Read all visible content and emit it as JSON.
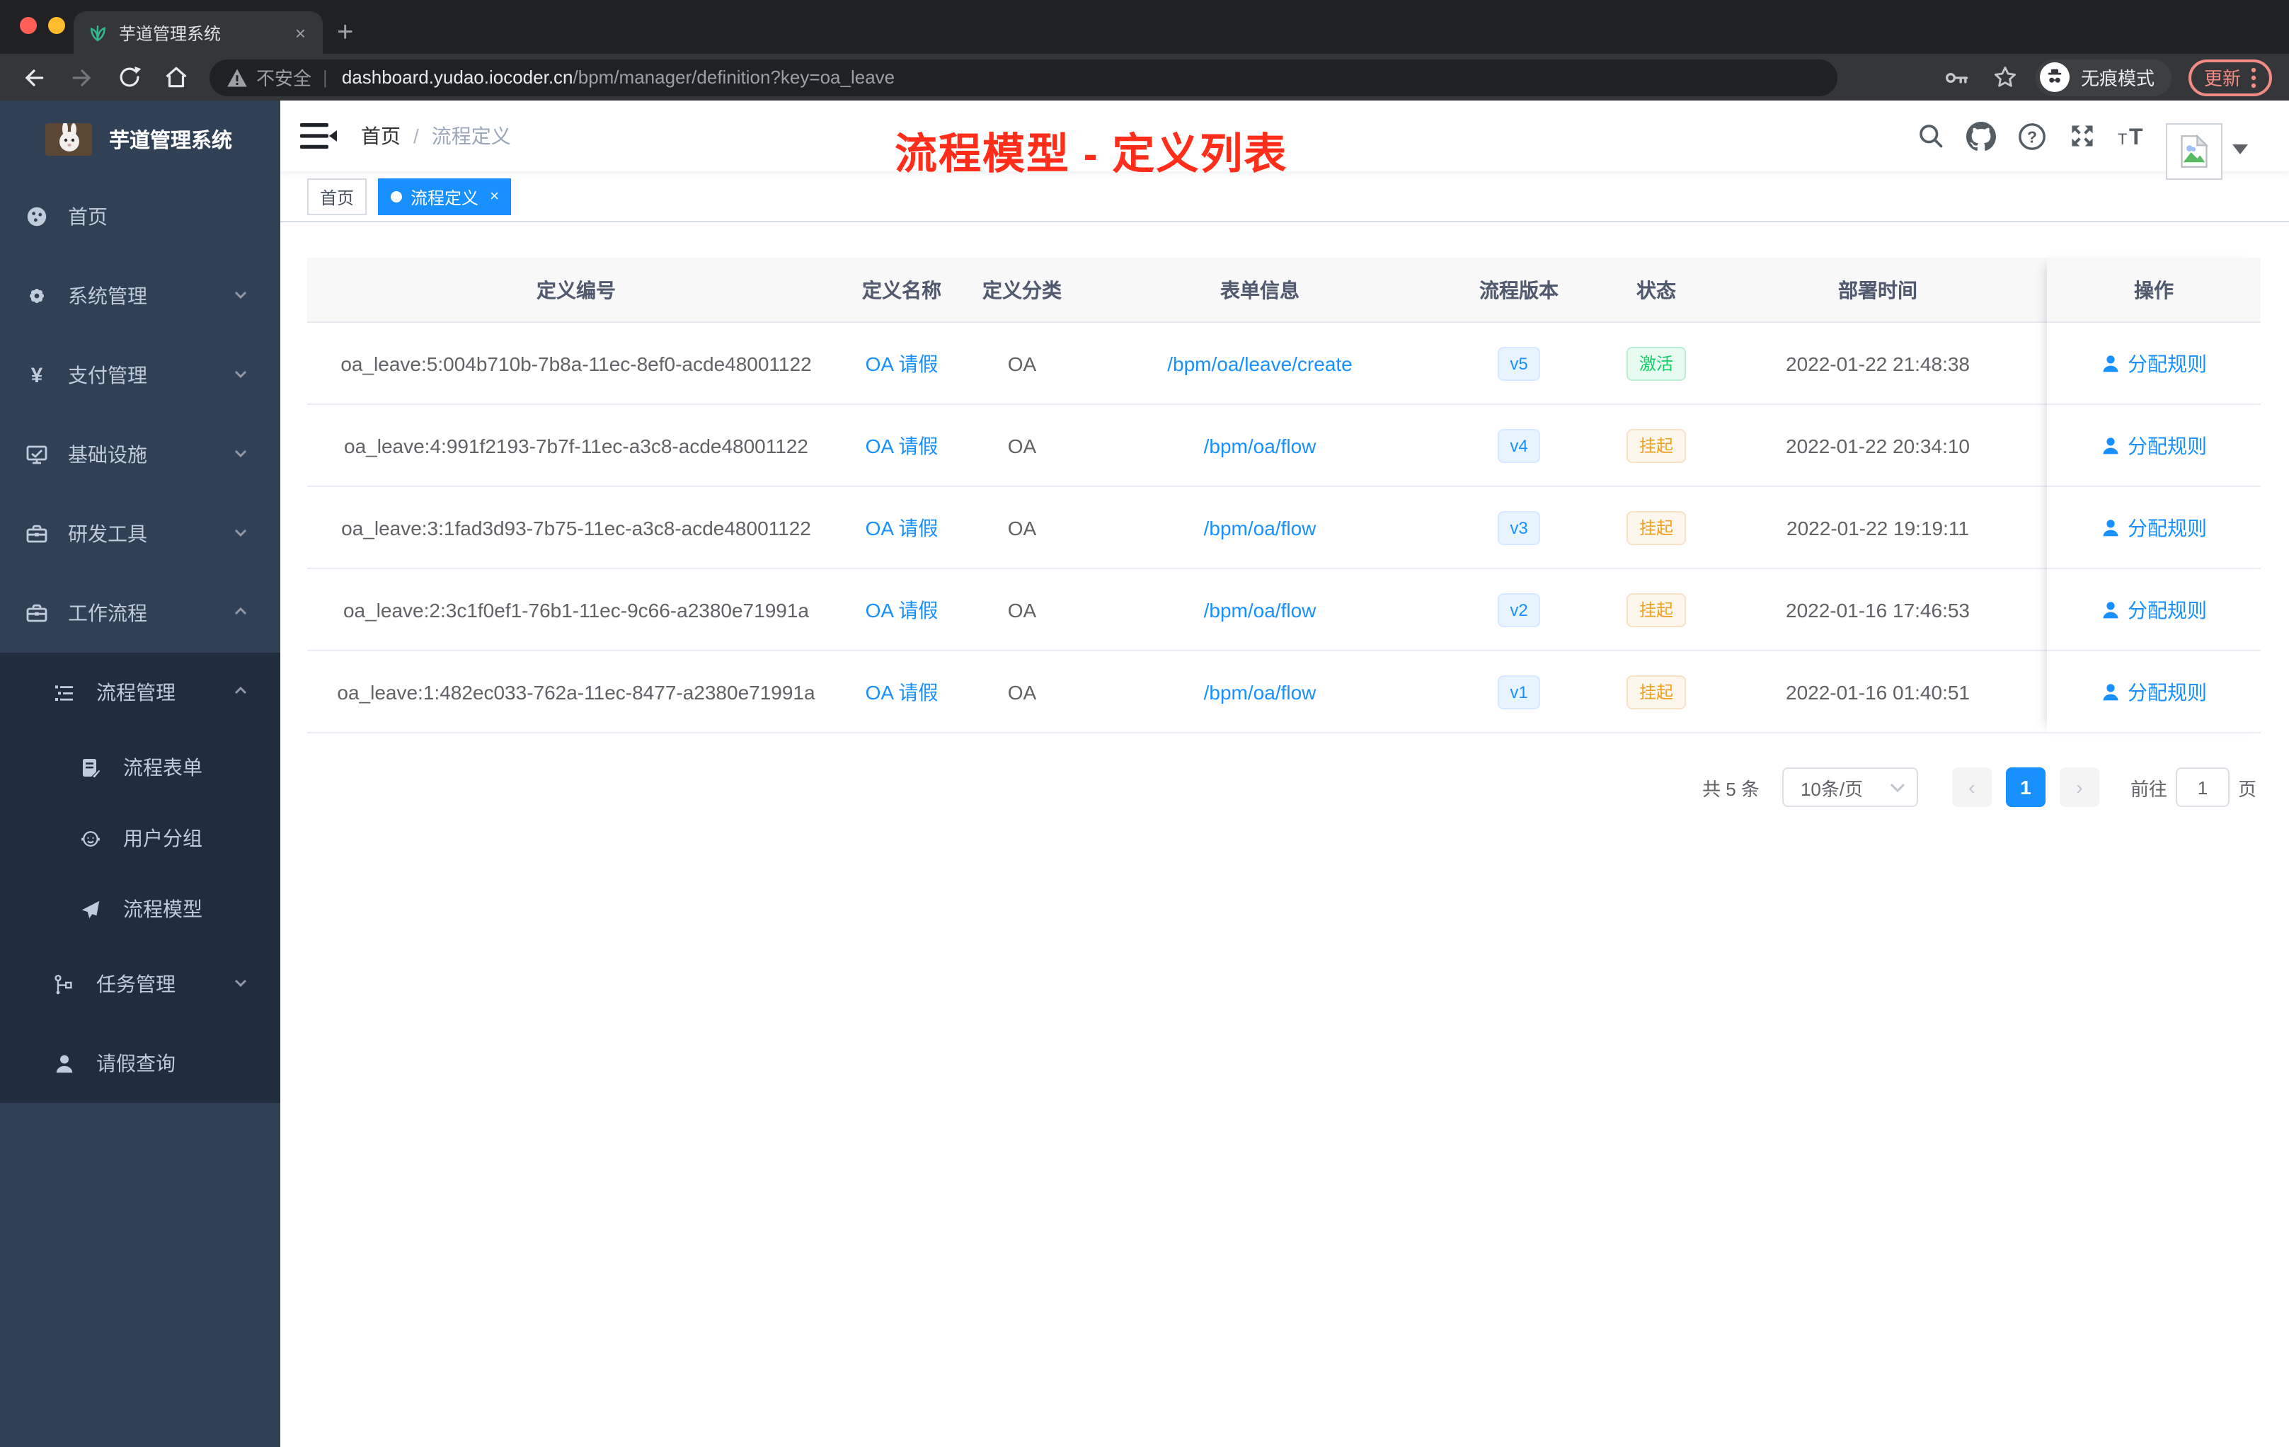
{
  "browser": {
    "tab_title": "芋道管理系统",
    "tab_close_glyph": "×",
    "new_tab_glyph": "+",
    "security_label": "不安全",
    "url_separator": "|",
    "url_domain": "dashboard.yudao.iocoder.cn",
    "url_path": "/bpm/manager/definition?key=oa_leave",
    "incognito_label": "无痕模式",
    "update_label": "更新",
    "window_colors": {
      "close": "#ff5f57",
      "minimize": "#febc2e",
      "zoom": "#28c840"
    }
  },
  "sidebar": {
    "title": "芋道管理系统",
    "logo": "rabbit-avatar",
    "yuan_glyph": "¥",
    "colors": {
      "bg": "#304156",
      "submenu_bg": "#1f2d3d",
      "text": "#bfcbd9"
    },
    "items": [
      {
        "label": "首页",
        "icon": "dashboard-icon",
        "level": 1
      },
      {
        "label": "系统管理",
        "icon": "gear-icon",
        "level": 1,
        "chevron": "down"
      },
      {
        "label": "支付管理",
        "icon": "yuan-icon",
        "level": 1,
        "chevron": "down"
      },
      {
        "label": "基础设施",
        "icon": "monitor-icon",
        "level": 1,
        "chevron": "down"
      },
      {
        "label": "研发工具",
        "icon": "toolbox-icon",
        "level": 1,
        "chevron": "down"
      },
      {
        "label": "工作流程",
        "icon": "briefcase-icon",
        "level": 1,
        "chevron": "up",
        "expanded": true
      },
      {
        "label": "流程管理",
        "icon": "list-tree-icon",
        "level": 2,
        "chevron": "up",
        "expanded": true
      },
      {
        "label": "流程表单",
        "icon": "form-doc-icon",
        "level": 3
      },
      {
        "label": "用户分组",
        "icon": "user-group-icon",
        "level": 3
      },
      {
        "label": "流程模型",
        "icon": "paper-plane-icon",
        "level": 3
      },
      {
        "label": "任务管理",
        "icon": "flow-icon",
        "level": 2,
        "chevron": "down"
      },
      {
        "label": "请假查询",
        "icon": "person-icon",
        "level": 2
      }
    ]
  },
  "topbar": {
    "breadcrumb": [
      "首页",
      "流程定义"
    ],
    "separator": "/",
    "icons": [
      "search-icon",
      "github-icon",
      "help-icon",
      "fullscreen-icon",
      "font-size-icon"
    ],
    "avatar": "broken-image"
  },
  "annotation": {
    "text": "流程模型 - 定义列表",
    "color": "#ff2d1a"
  },
  "tags": [
    {
      "label": "首页",
      "active": false
    },
    {
      "label": "流程定义",
      "active": true,
      "close_glyph": "×"
    }
  ],
  "table": {
    "headers": [
      "定义编号",
      "定义名称",
      "定义分类",
      "表单信息",
      "流程版本",
      "状态",
      "部署时间",
      "操作"
    ],
    "rows": [
      {
        "id": "oa_leave:5:004b710b-7b8a-11ec-8ef0-acde48001122",
        "name": "OA 请假",
        "category": "OA",
        "form": "/bpm/oa/leave/create",
        "version": "v5",
        "status": "激活",
        "status_type": "success",
        "deploy_time": "2022-01-22 21:48:38",
        "action": "分配规则"
      },
      {
        "id": "oa_leave:4:991f2193-7b7f-11ec-a3c8-acde48001122",
        "name": "OA 请假",
        "category": "OA",
        "form": "/bpm/oa/flow",
        "version": "v4",
        "status": "挂起",
        "status_type": "warning",
        "deploy_time": "2022-01-22 20:34:10",
        "action": "分配规则"
      },
      {
        "id": "oa_leave:3:1fad3d93-7b75-11ec-a3c8-acde48001122",
        "name": "OA 请假",
        "category": "OA",
        "form": "/bpm/oa/flow",
        "version": "v3",
        "status": "挂起",
        "status_type": "warning",
        "deploy_time": "2022-01-22 19:19:11",
        "action": "分配规则"
      },
      {
        "id": "oa_leave:2:3c1f0ef1-76b1-11ec-9c66-a2380e71991a",
        "name": "OA 请假",
        "category": "OA",
        "form": "/bpm/oa/flow",
        "version": "v2",
        "status": "挂起",
        "status_type": "warning",
        "deploy_time": "2022-01-16 17:46:53",
        "action": "分配规则"
      },
      {
        "id": "oa_leave:1:482ec033-762a-11ec-8477-a2380e71991a",
        "name": "OA 请假",
        "category": "OA",
        "form": "/bpm/oa/flow",
        "version": "v1",
        "status": "挂起",
        "status_type": "warning",
        "deploy_time": "2022-01-16 01:40:51",
        "action": "分配规则"
      }
    ]
  },
  "pagination": {
    "total": "共 5 条",
    "page_size": "10条/页",
    "prev": "‹",
    "page": "1",
    "next": "›",
    "goto_label": "前往",
    "goto_value": "1",
    "unit": "页"
  },
  "theme": {
    "accent": "#1890ff",
    "success": "#13ce66",
    "warning": "#f0a020",
    "sidebar": "#304156"
  }
}
